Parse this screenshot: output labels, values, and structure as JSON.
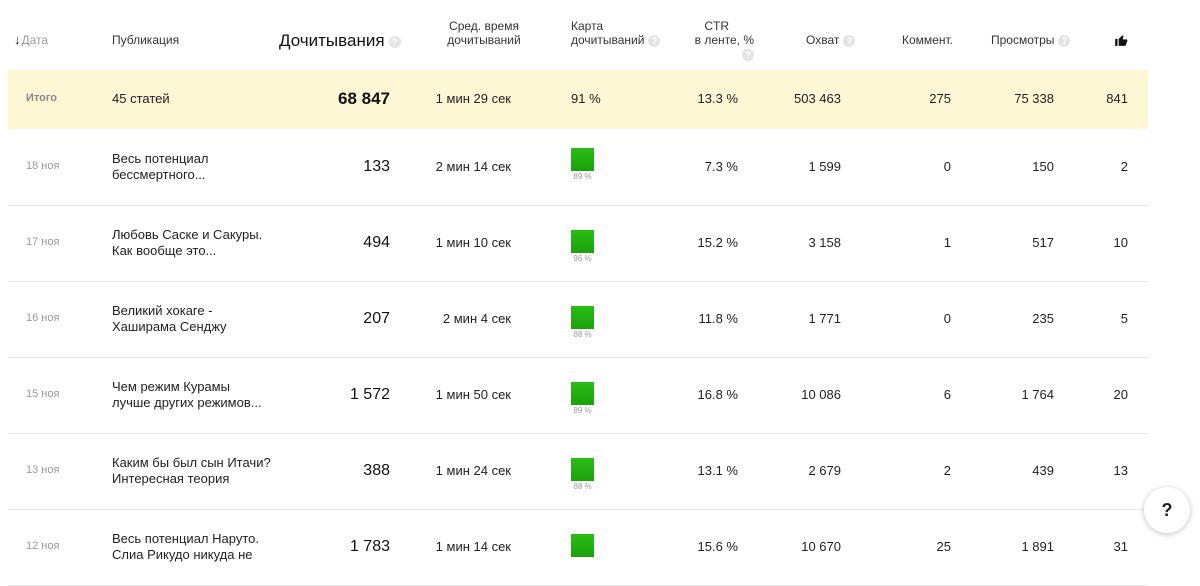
{
  "header": {
    "date": "Дата",
    "publication": "Публикация",
    "reads": "Дочитывания",
    "avg_time_1": "Сред. время",
    "avg_time_2": "дочитываний",
    "map_1": "Карта",
    "map_2": "дочитываний",
    "ctr_1": "CTR",
    "ctr_2": "в ленте, %",
    "reach": "Охват",
    "comments": "Коммент.",
    "views": "Просмотры",
    "help_glyph": "?",
    "sort_arrow": "↓"
  },
  "total": {
    "label": "Итого",
    "articles": "45 статей",
    "reads": "68 847",
    "avg_time": "1 мин 29 сек",
    "map": "91 %",
    "ctr": "13.3 %",
    "reach": "503 463",
    "comments": "275",
    "views": "75 338",
    "likes": "841"
  },
  "rows": [
    {
      "date": "18 ноя",
      "title_1": "Весь потенциал",
      "title_2": "бессмертного...",
      "reads": "133",
      "avg_time": "2 мин 14 сек",
      "map_pct": "89 %",
      "map_value": 89,
      "ctr": "7.3 %",
      "reach": "1 599",
      "comments": "0",
      "views": "150",
      "likes": "2"
    },
    {
      "date": "17 ноя",
      "title_1": "Любовь Саске и Сакуры.",
      "title_2": "Как вообще это...",
      "reads": "494",
      "avg_time": "1 мин 10 сек",
      "map_pct": "96 %",
      "map_value": 96,
      "ctr": "15.2 %",
      "reach": "3 158",
      "comments": "1",
      "views": "517",
      "likes": "10"
    },
    {
      "date": "16 ноя",
      "title_1": "Великий хокаге -",
      "title_2": "Хаширама Сенджу",
      "reads": "207",
      "avg_time": "2 мин 4 сек",
      "map_pct": "88 %",
      "map_value": 88,
      "ctr": "11.8 %",
      "reach": "1 771",
      "comments": "0",
      "views": "235",
      "likes": "5"
    },
    {
      "date": "15 ноя",
      "title_1": "Чем режим Курамы",
      "title_2": "лучше других режимов...",
      "reads": "1 572",
      "avg_time": "1 мин 50 сек",
      "map_pct": "89 %",
      "map_value": 89,
      "ctr": "16.8 %",
      "reach": "10 086",
      "comments": "6",
      "views": "1 764",
      "likes": "20"
    },
    {
      "date": "13 ноя",
      "title_1": "Каким бы был сын Итачи?",
      "title_2": "Интересная теория",
      "reads": "388",
      "avg_time": "1 мин 24 сек",
      "map_pct": "88 %",
      "map_value": 88,
      "ctr": "13.1 %",
      "reach": "2 679",
      "comments": "2",
      "views": "439",
      "likes": "13"
    },
    {
      "date": "12 ноя",
      "title_1": "Весь потенциал Наруто.",
      "title_2": "Слиа Рикудо никуда не",
      "reads": "1 783",
      "avg_time": "1 мин 14 сек",
      "map_pct": "",
      "map_value": 90,
      "ctr": "15.6 %",
      "reach": "10 670",
      "comments": "25",
      "views": "1 891",
      "likes": "31"
    }
  ],
  "help_button": "?",
  "colors": {
    "total_bg": "#fdf7d6",
    "map_green": "#1faa0d",
    "divider": "#e8e8e8"
  },
  "icons": {
    "likes": "thumb-up-icon",
    "sort": "arrow-down-icon",
    "hint": "question-circle-icon"
  }
}
